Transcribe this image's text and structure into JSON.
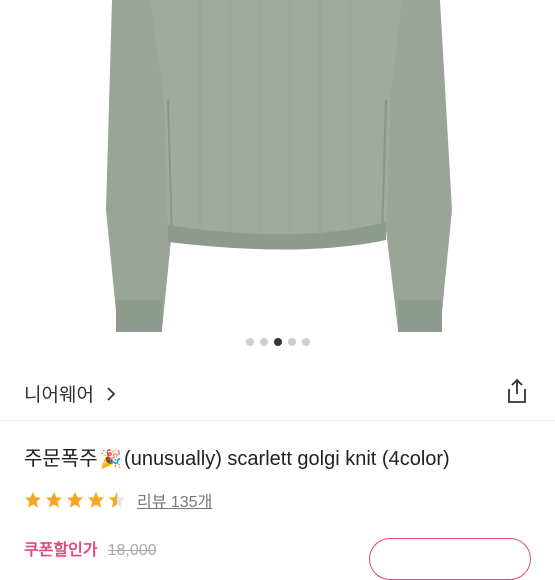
{
  "carousel": {
    "dot_count": 5,
    "active_index": 2,
    "image_colors": {
      "sweater": "#9ea89d",
      "sweater_dark": "#8a9489",
      "sweater_light": "#aab3a8"
    }
  },
  "brand": {
    "name": "니어웨어"
  },
  "product": {
    "title_prefix": "주문폭주",
    "title_emoji": "🎉",
    "title_main": "(unusually) scarlett golgi knit (4color)"
  },
  "rating": {
    "score": 4.5,
    "max": 5,
    "star_color": "#f5a623",
    "review_text": "리뷰 135개"
  },
  "price": {
    "coupon_label": "쿠폰할인가",
    "original": "18,000",
    "accent_color": "#e2487f"
  },
  "icons": {
    "share": "share-icon",
    "chevron": "chevron-right-icon",
    "star": "star-icon"
  }
}
